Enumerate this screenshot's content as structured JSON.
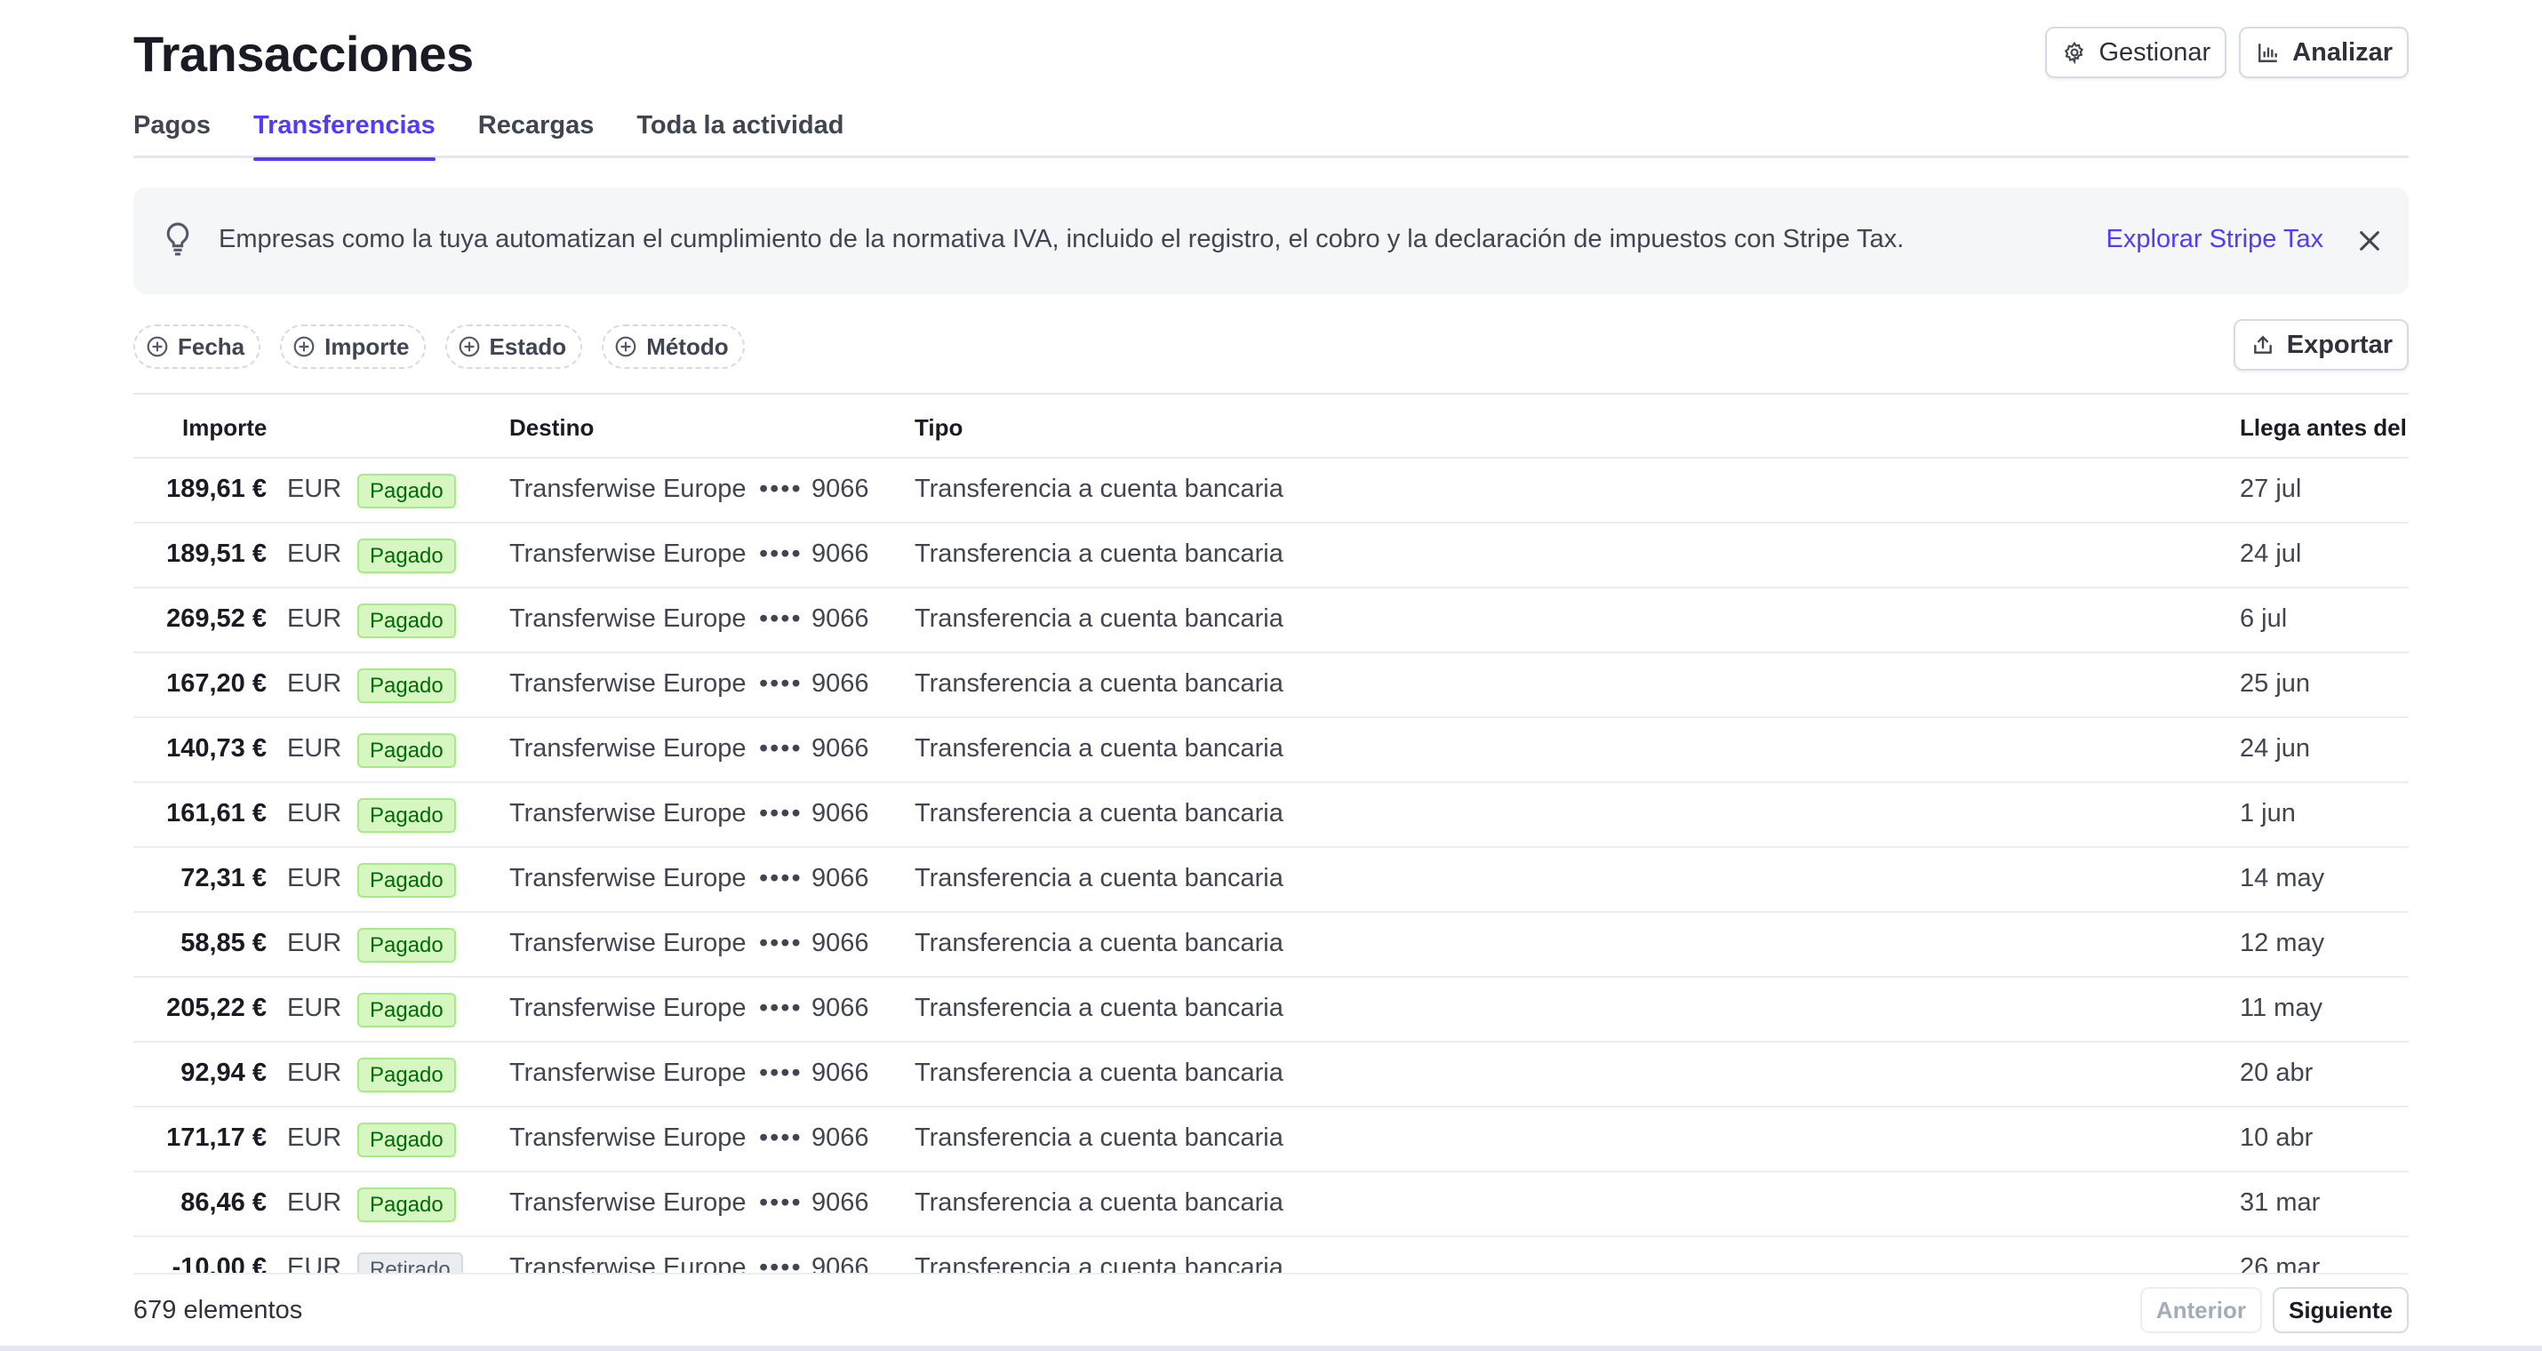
{
  "header": {
    "title": "Transacciones",
    "manage_label": "Gestionar",
    "analyze_label": "Analizar"
  },
  "tabs": [
    {
      "label": "Pagos",
      "active": false
    },
    {
      "label": "Transferencias",
      "active": true
    },
    {
      "label": "Recargas",
      "active": false
    },
    {
      "label": "Toda la actividad",
      "active": false
    }
  ],
  "banner": {
    "text": "Empresas como la tuya automatizan el cumplimiento de la normativa IVA, incluido el registro, el cobro y la declaración de impuestos con Stripe Tax.",
    "link_label": "Explorar Stripe Tax"
  },
  "filters": [
    {
      "label": "Fecha"
    },
    {
      "label": "Importe"
    },
    {
      "label": "Estado"
    },
    {
      "label": "Método"
    }
  ],
  "export_label": "Exportar",
  "table": {
    "columns": {
      "amount": "Importe",
      "destination": "Destino",
      "type": "Tipo",
      "arrival": "Llega antes del"
    },
    "rows": [
      {
        "amount": "189,61 €",
        "currency": "EUR",
        "status": "Pagado",
        "status_kind": "paid",
        "destination": "Transferwise Europe",
        "mask": "••••",
        "account": "9066",
        "type": "Transferencia a cuenta bancaria",
        "date": "27 jul"
      },
      {
        "amount": "189,51 €",
        "currency": "EUR",
        "status": "Pagado",
        "status_kind": "paid",
        "destination": "Transferwise Europe",
        "mask": "••••",
        "account": "9066",
        "type": "Transferencia a cuenta bancaria",
        "date": "24 jul"
      },
      {
        "amount": "269,52 €",
        "currency": "EUR",
        "status": "Pagado",
        "status_kind": "paid",
        "destination": "Transferwise Europe",
        "mask": "••••",
        "account": "9066",
        "type": "Transferencia a cuenta bancaria",
        "date": "6 jul"
      },
      {
        "amount": "167,20 €",
        "currency": "EUR",
        "status": "Pagado",
        "status_kind": "paid",
        "destination": "Transferwise Europe",
        "mask": "••••",
        "account": "9066",
        "type": "Transferencia a cuenta bancaria",
        "date": "25 jun"
      },
      {
        "amount": "140,73 €",
        "currency": "EUR",
        "status": "Pagado",
        "status_kind": "paid",
        "destination": "Transferwise Europe",
        "mask": "••••",
        "account": "9066",
        "type": "Transferencia a cuenta bancaria",
        "date": "24 jun"
      },
      {
        "amount": "161,61 €",
        "currency": "EUR",
        "status": "Pagado",
        "status_kind": "paid",
        "destination": "Transferwise Europe",
        "mask": "••••",
        "account": "9066",
        "type": "Transferencia a cuenta bancaria",
        "date": "1 jun"
      },
      {
        "amount": "72,31 €",
        "currency": "EUR",
        "status": "Pagado",
        "status_kind": "paid",
        "destination": "Transferwise Europe",
        "mask": "••••",
        "account": "9066",
        "type": "Transferencia a cuenta bancaria",
        "date": "14 may"
      },
      {
        "amount": "58,85 €",
        "currency": "EUR",
        "status": "Pagado",
        "status_kind": "paid",
        "destination": "Transferwise Europe",
        "mask": "••••",
        "account": "9066",
        "type": "Transferencia a cuenta bancaria",
        "date": "12 may"
      },
      {
        "amount": "205,22 €",
        "currency": "EUR",
        "status": "Pagado",
        "status_kind": "paid",
        "destination": "Transferwise Europe",
        "mask": "••••",
        "account": "9066",
        "type": "Transferencia a cuenta bancaria",
        "date": "11 may"
      },
      {
        "amount": "92,94 €",
        "currency": "EUR",
        "status": "Pagado",
        "status_kind": "paid",
        "destination": "Transferwise Europe",
        "mask": "••••",
        "account": "9066",
        "type": "Transferencia a cuenta bancaria",
        "date": "20 abr"
      },
      {
        "amount": "171,17 €",
        "currency": "EUR",
        "status": "Pagado",
        "status_kind": "paid",
        "destination": "Transferwise Europe",
        "mask": "••••",
        "account": "9066",
        "type": "Transferencia a cuenta bancaria",
        "date": "10 abr"
      },
      {
        "amount": "86,46 €",
        "currency": "EUR",
        "status": "Pagado",
        "status_kind": "paid",
        "destination": "Transferwise Europe",
        "mask": "••••",
        "account": "9066",
        "type": "Transferencia a cuenta bancaria",
        "date": "31 mar"
      },
      {
        "amount": "-10,00 €",
        "currency": "EUR",
        "status": "Retirado",
        "status_kind": "retired",
        "destination": "Transferwise Europe",
        "mask": "••••",
        "account": "9066",
        "type": "Transferencia a cuenta bancaria",
        "date": "26 mar"
      }
    ]
  },
  "footer": {
    "count_label": "679 elementos",
    "prev_label": "Anterior",
    "next_label": "Siguiente"
  },
  "colors": {
    "accent": "#533afd",
    "paid_bg": "#d7f7c2",
    "paid_text": "#006908",
    "retired_bg": "#ebeef1"
  }
}
